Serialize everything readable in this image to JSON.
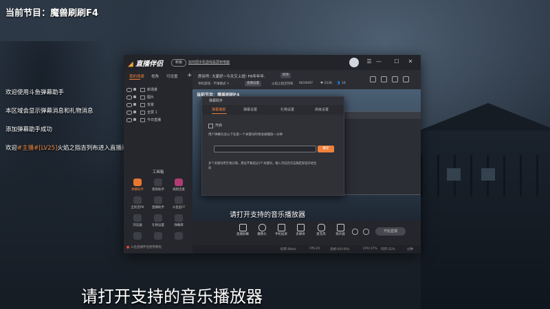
{
  "overlay": {
    "program_title": "当前节目：魔兽刷刷F4",
    "chat": [
      {
        "text": "欢迎使用斗鱼弹幕助手"
      },
      {
        "text": "本区域会显示弹幕消息和礼物消息"
      },
      {
        "text": "添加弹幕助手成功"
      }
    ],
    "welcome": {
      "prefix": "欢迎",
      "highlight": "#主播#[LV25]",
      "suffix": "火焰之指吉列布进入直播间"
    },
    "subtitle": "请打开支持的音乐播放器"
  },
  "app": {
    "logo": "直播伴侣",
    "pill": "新版",
    "notice": "如何把手机游戏投屏到电脑",
    "window_controls": [
      "☰",
      "—",
      "☐",
      "✕"
    ],
    "left_tabs": [
      "我的场景",
      "视角",
      "可设置"
    ],
    "add_label": "+",
    "sources": [
      "新场景",
      "图片",
      "背景",
      "全屏 1",
      "今日直播"
    ],
    "tools_title": "工具箱",
    "tools": [
      {
        "label": "弹幕助手",
        "style": "orange"
      },
      {
        "label": "感恩助手",
        "style": ""
      },
      {
        "label": "视频连麦",
        "style": "pink"
      },
      {
        "label": "全民连PK",
        "style": ""
      },
      {
        "label": "直播助手",
        "style": ""
      },
      {
        "label": "斗鱼鱼FF",
        "style": ""
      },
      {
        "label": "浏览器",
        "style": ""
      },
      {
        "label": "礼物设置",
        "style": ""
      },
      {
        "label": "弹幕库",
        "style": ""
      },
      {
        "label": "",
        "style": ""
      },
      {
        "label": "",
        "style": ""
      },
      {
        "label": "",
        "style": ""
      }
    ],
    "footer": "斗鱼直播伴侣使用教程",
    "room_text": "房间号: 大家好~今天又上班! F6年年年.",
    "room_chip": "修改",
    "category": "单机游戏 - 不限模式 ✎",
    "category_chip": "直播设置",
    "stats": [
      "火焰之指吉列布",
      "6819497",
      "♥ 2236",
      "👤 16"
    ],
    "preview_title": "当前节目：魔兽刷刷F4",
    "preview_subtitle": "请打开支持的音乐播放器",
    "bottom_tools": [
      "直播屏幕",
      "摄像头",
      "手机投屏",
      "多媒体",
      "麦克风",
      "扬声器"
    ],
    "start_button": "开始直播",
    "status": [
      "码率:0kb/s",
      "FPS:25",
      "丢帧:0(0.0%)",
      "CPU:17%",
      "内存:21%",
      "分钟"
    ]
  },
  "dialog": {
    "title": "弹幕助手",
    "tabs": [
      "弹幕播报",
      "弹幕设置",
      "礼物设置",
      "高级设置"
    ],
    "checkbox_label": "开启",
    "description": "用户弹幕包含以下任意一个关键词时将会被播放一分钟",
    "input_value": "",
    "button": "确定",
    "note1": "多个关键词用空格分隔，建议不要超过3个关键词，输入完成后点击确定按钮开始生",
    "note2": "效"
  },
  "colors": {
    "accent": "#f0823c",
    "app_bg": "#2a2c33",
    "text": "#ffffff"
  }
}
